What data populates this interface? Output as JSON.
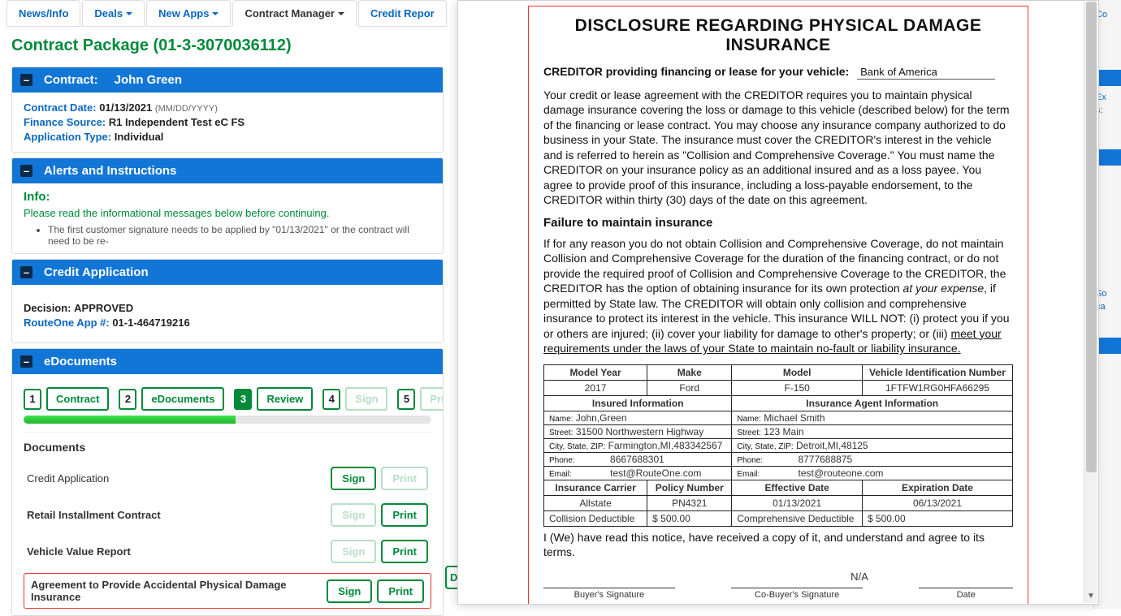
{
  "nav": {
    "tabs": [
      {
        "label": "News/Info"
      },
      {
        "label": "Deals"
      },
      {
        "label": "New Apps"
      },
      {
        "label": "Contract Manager"
      },
      {
        "label": "Credit Repor"
      }
    ],
    "active_index": 3
  },
  "page_title": "Contract Package (01-3-3070036112)",
  "contract_panel": {
    "heading_label": "Contract:",
    "heading_name": "John Green",
    "fields": {
      "date_label": "Contract Date:",
      "date_value": "01/13/2021",
      "date_hint": "(MM/DD/YYYY)",
      "fin_label": "Finance Source:",
      "fin_value": "R1 Independent Test eC FS",
      "apptype_label": "Application Type:",
      "apptype_value": "Individual"
    }
  },
  "alerts_panel": {
    "heading": "Alerts and Instructions",
    "info_heading": "Info:",
    "info_msg": "Please read the informational messages below before continuing.",
    "bullets": [
      "The first customer signature needs to be applied by \"01/13/2021\" or the contract will need to be re-"
    ]
  },
  "credit_panel": {
    "heading": "Credit Application",
    "decision_label": "Decision:",
    "decision_value": "APPROVED",
    "appnum_label": "RouteOne App #:",
    "appnum_value": "01-1-464719216"
  },
  "edocs_panel": {
    "heading": "eDocuments",
    "steps": [
      {
        "num": "1",
        "label": "Contract"
      },
      {
        "num": "2",
        "label": "eDocuments"
      },
      {
        "num": "3",
        "label": "Review"
      },
      {
        "num": "4",
        "label": "Sign"
      },
      {
        "num": "5",
        "label": "Print"
      }
    ],
    "active_step_index": 2,
    "docs_heading": "Documents",
    "docs": [
      {
        "name": "Credit Application",
        "sign_enabled": true,
        "print_enabled": false,
        "bold": false
      },
      {
        "name": "Retail Installment Contract",
        "sign_enabled": false,
        "print_enabled": true,
        "bold": true
      },
      {
        "name": "Vehicle Value Report",
        "sign_enabled": false,
        "print_enabled": true,
        "bold": true
      },
      {
        "name": "Agreement to Provide Accidental Physical Damage Insurance",
        "sign_enabled": true,
        "print_enabled": true,
        "bold": true,
        "highlight": true
      }
    ],
    "sign_label": "Sign",
    "print_label": "Print",
    "edge_btn": "D"
  },
  "right_peek": {
    "items": [
      "Co",
      "Ex",
      "s:",
      "So",
      "ca"
    ]
  },
  "disclosure": {
    "title": "DISCLOSURE REGARDING PHYSICAL DAMAGE INSURANCE",
    "creditor_label": "CREDITOR providing financing or lease for your vehicle:",
    "creditor_value": "Bank of America",
    "para1": "Your credit or lease agreement with the CREDITOR requires you to maintain physical damage insurance covering the loss or damage to this vehicle (described below) for the term of the financing or lease contract. You may choose any insurance company authorized to do business in your State. The insurance must cover the CREDITOR's interest in the vehicle and is referred to herein as \"Collision and Comprehensive Coverage.\" You must name the CREDITOR on your insurance policy as an additional insured and as a loss payee. You agree to provide proof of this insurance, including a loss-payable endorsement, to the CREDITOR within thirty (30) days of the date on this agreement.",
    "sub": "Failure to maintain insurance",
    "para2_a": "If for any reason you do not obtain Collision and Comprehensive Coverage, do not maintain Collision and Comprehensive Coverage for the duration of the financing contract, or do not provide the required proof of Collision and Comprehensive Coverage to the CREDITOR, the CREDITOR has the option of obtaining insurance for its own protection ",
    "para2_ital": "at your expense",
    "para2_b": ", if permitted by State law. The CREDITOR will obtain only collision and comprehensive insurance to protect its interest in the vehicle. This insurance WILL NOT: (i) protect you if you or others are injured; (ii) cover your liability for damage to other's property; or (iii) ",
    "para2_und": "meet your requirements under the laws of your State to maintain no-fault or liability insurance.",
    "vehicle_headers": [
      "Model Year",
      "Make",
      "Model",
      "Vehicle Identification Number"
    ],
    "vehicle_values": [
      "2017",
      "Ford",
      "F-150",
      "1FTFW1RG0HFA66295"
    ],
    "insured_heading": "Insured Information",
    "agent_heading": "Insurance Agent Information",
    "labels": {
      "name": "Name:",
      "street": "Street:",
      "csz": "City, State, ZIP:",
      "phone": "Phone:",
      "email": "Email:"
    },
    "insured": {
      "name": "John,Green",
      "street": "31500 Northwestern Highway",
      "csz": "Farmington,MI,483342567",
      "phone": "8667688301",
      "email": "test@RouteOne.com"
    },
    "agent": {
      "name": "Michael Smith",
      "street": "123 Main",
      "csz": "Detroit,MI,48125",
      "phone": "8777688875",
      "email": "test@routeone.com"
    },
    "pol_headers": [
      "Insurance Carrier",
      "Policy Number",
      "Effective Date",
      "Expiration Date"
    ],
    "pol_values": [
      "Allstate",
      "PN4321",
      "01/13/2021",
      "06/13/2021"
    ],
    "collision_label": "Collision Deductible",
    "collision_amt": "$  500.00",
    "comp_label": "Comprehensive Deductible",
    "comp_amt": "$  500.00",
    "ack": "I (We) have read this notice, have received a copy of it, and understand and agree to its terms.",
    "na": "N/A",
    "sig": {
      "buyer": "Buyer's Signature",
      "cobuyer": "Co-Buyer's Signature",
      "date": "Date"
    }
  }
}
